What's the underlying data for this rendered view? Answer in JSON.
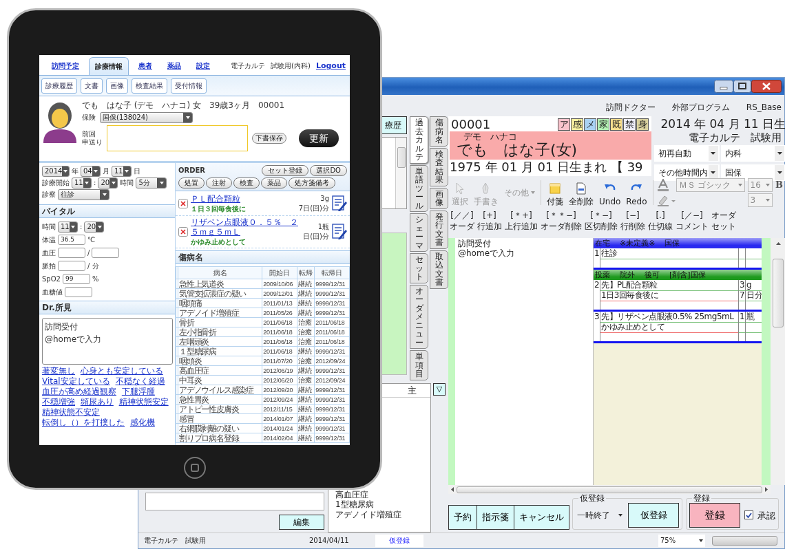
{
  "tablet": {
    "nav_tabs": [
      {
        "label": "訪問予定",
        "selected": false
      },
      {
        "label": "診療情報",
        "selected": true
      },
      {
        "label": "患者",
        "selected": false
      },
      {
        "label": "薬品",
        "selected": false
      },
      {
        "label": "設定",
        "selected": false
      }
    ],
    "app_name": "電子カルテ",
    "user": "試験用(内科)",
    "logout": "Logout",
    "sub_buttons": [
      "診療履歴",
      "文書",
      "画像",
      "検査結果",
      "受付情報"
    ],
    "patient": {
      "summary": "でも　はな子 (デモ　ハナコ) 女　39歳3ヶ月　00001",
      "insurance_label": "保険",
      "insurance": "国保(138024)",
      "handover_label": [
        "前回",
        "申送り"
      ],
      "draft_button": "下書保存",
      "update_button": "更新"
    },
    "visit_rows": [
      [
        {
          "kind": "select",
          "value": "2014"
        },
        {
          "kind": "label",
          "text": "年"
        },
        {
          "kind": "select",
          "value": "04"
        },
        {
          "kind": "label",
          "text": "月"
        },
        {
          "kind": "select",
          "value": "11"
        },
        {
          "kind": "label",
          "text": "日"
        }
      ],
      [
        {
          "kind": "label",
          "text": "診療開始"
        },
        {
          "kind": "select",
          "value": "11"
        },
        {
          "kind": "label",
          "text": ":"
        },
        {
          "kind": "select",
          "value": "20"
        },
        {
          "kind": "label",
          "text": "時間"
        },
        {
          "kind": "select",
          "value": "5分"
        }
      ],
      [
        {
          "kind": "label",
          "text": "診察"
        },
        {
          "kind": "select",
          "value": "往診"
        }
      ]
    ],
    "vitals": {
      "title": "バイタル",
      "rows": [
        [
          {
            "kind": "label",
            "text": "時間"
          },
          {
            "kind": "select",
            "value": "11"
          },
          {
            "kind": "label",
            "text": ":"
          },
          {
            "kind": "select",
            "value": "20"
          }
        ],
        [
          {
            "kind": "label",
            "text": "体温"
          },
          {
            "kind": "input",
            "value": "36.5"
          },
          {
            "kind": "label",
            "text": "℃"
          }
        ],
        [
          {
            "kind": "label",
            "text": "血圧"
          },
          {
            "kind": "input"
          },
          {
            "kind": "label",
            "text": "/"
          },
          {
            "kind": "input"
          }
        ],
        [
          {
            "kind": "label",
            "text": "脈拍"
          },
          {
            "kind": "input"
          },
          {
            "kind": "label",
            "text": "/ 分"
          }
        ],
        [
          {
            "kind": "label",
            "text": "SpO2"
          },
          {
            "kind": "input",
            "value": "99"
          },
          {
            "kind": "label",
            "text": "%"
          }
        ],
        [
          {
            "kind": "label",
            "text": "血糖値"
          },
          {
            "kind": "input"
          }
        ]
      ]
    },
    "findings": {
      "title": "Dr.所見",
      "notes": "訪問受付\n@homeで入力",
      "phrases": [
        "著変無し",
        "心身とも安定している",
        "Vital安定している",
        "不穏なく経過",
        "血圧が高め経過観察",
        "下腿浮腫",
        "不穏増強",
        "頻尿あり",
        "精神状態安定",
        "精神状態不安定",
        "転倒し（）を打撲した",
        "感化機"
      ]
    },
    "order": {
      "title": "ORDER",
      "top_buttons": [
        "セット登録",
        "選択DO"
      ],
      "category_buttons": [
        "処置",
        "注射",
        "検査",
        "薬品",
        "処方箋備考"
      ],
      "items": [
        {
          "name": "ＰＬ配合顆粒",
          "usage": "１日３回毎食後に",
          "amount": "3g",
          "days": "7日(回)分"
        },
        {
          "name": "リザベン点眼液０．５％　２５ｍｇ５ｍＬ",
          "usage": "かゆみ止めとして",
          "amount": "1瓶",
          "days": "日(回)分"
        }
      ]
    },
    "diseases": {
      "title": "傷病名",
      "columns": [
        "病名",
        "開始日",
        "転帰",
        "転帰日"
      ],
      "rows": [
        [
          "急性上気道炎",
          "2009/10/06",
          "継続",
          "9999/12/31"
        ],
        [
          "気管支拡張症の疑い",
          "2009/12/01",
          "継続",
          "9999/12/31"
        ],
        [
          "咽頭痛",
          "2011/01/13",
          "継続",
          "9999/12/31"
        ],
        [
          "アデノイド増殖症",
          "2011/05/26",
          "継続",
          "9999/12/31"
        ],
        [
          "骨折",
          "2011/06/18",
          "治癒",
          "2011/06/18"
        ],
        [
          "左小指骨折",
          "2011/06/18",
          "治癒",
          "2011/06/18"
        ],
        [
          "左咽頭炎",
          "2011/06/18",
          "治癒",
          "2011/06/18"
        ],
        [
          "１型糖尿病",
          "2011/06/18",
          "継続",
          "9999/12/31"
        ],
        [
          "咽頭炎",
          "2011/07/20",
          "治癒",
          "2012/09/24"
        ],
        [
          "高血圧症",
          "2012/06/19",
          "継続",
          "9999/12/31"
        ],
        [
          "中耳炎",
          "2012/06/20",
          "治癒",
          "2012/09/24"
        ],
        [
          "アデノウイルス感染症",
          "2012/09/20",
          "継続",
          "9999/12/31"
        ],
        [
          "急性胃炎",
          "2012/09/24",
          "継続",
          "9999/12/31"
        ],
        [
          "アトピー性皮膚炎",
          "2012/11/15",
          "継続",
          "9999/12/31"
        ],
        [
          "感冒",
          "2014/01/07",
          "継続",
          "9999/12/31"
        ],
        [
          "右網膜剥離の疑い",
          "2014/01/24",
          "継続",
          "9999/12/31"
        ],
        [
          "割りプロ病名登録",
          "2014/02/04",
          "継続",
          "9999/12/31"
        ]
      ]
    }
  },
  "desktop": {
    "menu_links": [
      "訪問ドクター",
      "外部プログラム",
      "RS_Base"
    ],
    "history_tab": "療歴",
    "tabs_inner": [
      {
        "label": "過去カルテ",
        "selected": true
      },
      {
        "label": "単語ツール",
        "selected": false
      },
      {
        "label": "シェーマ",
        "selected": false
      },
      {
        "label": "セット",
        "selected": false
      },
      {
        "label": "オーダメニュー",
        "selected": false
      },
      {
        "label": "単項目",
        "selected": false
      }
    ],
    "tabs_outer": [
      {
        "label": "傷病名",
        "selected": false
      },
      {
        "label": "検査結果",
        "selected": false
      },
      {
        "label": "画像",
        "selected": false
      },
      {
        "label": "発行文書",
        "selected": false
      },
      {
        "label": "取込文書",
        "selected": false
      }
    ],
    "patient_header": {
      "id": "00001",
      "flags": [
        {
          "label": "ア",
          "color": "#f9c3cc"
        },
        {
          "label": "感",
          "color": "#f7f0a0"
        },
        {
          "label": "メ",
          "color": "#a9d2f3"
        },
        {
          "label": "家",
          "color": "#b3f0b3"
        },
        {
          "label": "既",
          "color": "#f8df8f"
        },
        {
          "label": "禁",
          "color": "#ececf8"
        },
        {
          "label": "身",
          "color": "#d9d19f"
        }
      ],
      "kana": "デモ　ハナコ",
      "name": "でも　はな子(女)",
      "birth": "1975 年 01 月 01 日生まれ 【 39"
    },
    "date_header": "2014 年 04 月 11 日生",
    "system_label": "電子カルテ　試験用",
    "selects": [
      "初再自動",
      "内科",
      "その他時間内",
      "国保"
    ],
    "tools": [
      {
        "kind": "tool",
        "label": "選択",
        "disabled": true
      },
      {
        "kind": "tool",
        "label": "手書き",
        "disabled": true
      },
      {
        "kind": "menu",
        "label": "その他",
        "disabled": true
      },
      {
        "kind": "tool",
        "label": "付箋",
        "disabled": false
      },
      {
        "kind": "tool",
        "label": "全削除",
        "disabled": false
      },
      {
        "kind": "tool",
        "label": "Undo",
        "disabled": false
      },
      {
        "kind": "tool",
        "label": "Redo",
        "disabled": false
      }
    ],
    "font": {
      "family": "ＭＳ ゴシック",
      "size": "16",
      "bold": "B",
      "line": "3"
    },
    "order_commands": [
      {
        "keys": "[／／]",
        "label": "オーダ"
      },
      {
        "keys": "[+]",
        "label": "行追加"
      },
      {
        "keys": "[＊+]",
        "label": "上行追加"
      },
      {
        "keys": "[＊＊−]",
        "label": "オーダ削除"
      },
      {
        "keys": "[＊−]",
        "label": "区切削除"
      },
      {
        "keys": "[−]",
        "label": "行削除"
      },
      {
        "keys": "[.]",
        "label": "仕切線"
      },
      {
        "keys": "[／−]",
        "label": "コメント"
      },
      {
        "keys": "オーダ",
        "label": "セット"
      }
    ],
    "editor": {
      "notes": "訪問受付\n@homeで入力",
      "order_sheet": [
        {
          "color": "#2a2af0",
          "header": [
            "在宅",
            "※未定義※",
            "国保"
          ],
          "entries": [
            {
              "no": "1",
              "lines": [
                {
                  "text": "往診"
                }
              ]
            }
          ]
        },
        {
          "color": "#1e9a1e",
          "header": [
            "投薬",
            "院外",
            "後可",
            "[剤含]国保"
          ],
          "entries": [
            {
              "no": "2",
              "lines": [
                {
                  "text": "先】PL配合顆粒",
                  "qty": "3",
                  "unit": "g"
                },
                {
                  "text": "1日3回毎食後に",
                  "qty": "7",
                  "unit": "日分"
                }
              ]
            },
            {
              "no": "3",
              "lines": [
                {
                  "text": "先】リザベン点眼液0.5%  25mg5mL",
                  "qty": "1",
                  "unit": "瓶"
                },
                {
                  "text": "かゆみ止めとして"
                }
              ]
            }
          ]
        }
      ]
    },
    "disease_list": {
      "header": "主",
      "items": [
        "高血圧症",
        "1型糖尿病",
        "アデノイド増殖症"
      ]
    },
    "filter_button": "▽",
    "edit_button": "編集",
    "actions": [
      "予約",
      "指示箋",
      "キャンセル"
    ],
    "temp": {
      "title": "仮登録",
      "select": "一時終了",
      "button": "仮登録"
    },
    "register": {
      "title": "登録",
      "button": "登録",
      "approve": {
        "label": "承認",
        "checked": true
      }
    },
    "status_bar": {
      "app": "電子カルテ　試験用",
      "date": "2014/04/11",
      "state": "仮登録",
      "zoom": "75%"
    }
  }
}
